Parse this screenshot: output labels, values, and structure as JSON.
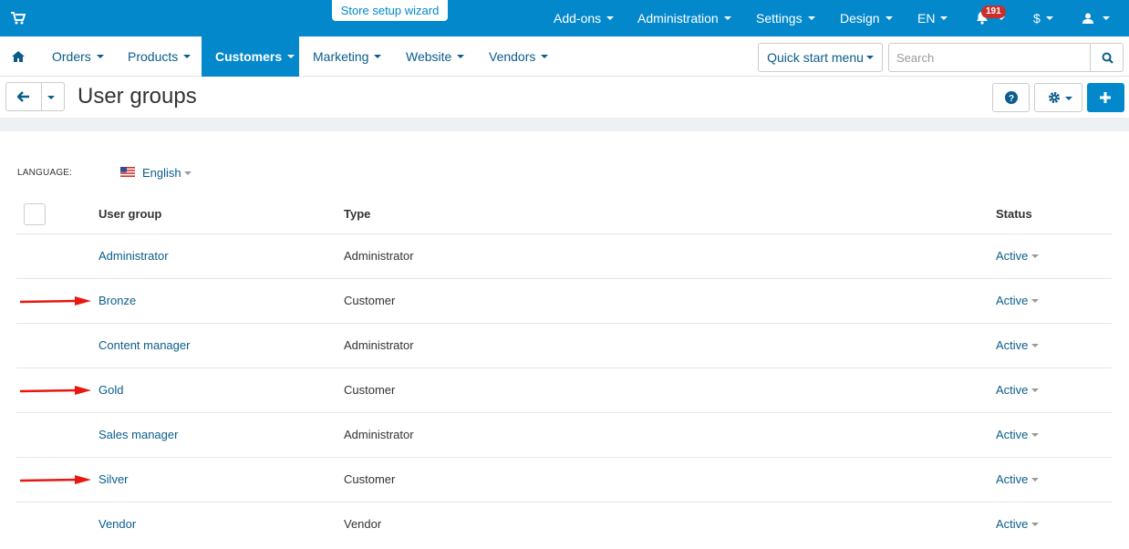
{
  "topbar": {
    "wizard_label": "Store setup wizard",
    "menus": [
      "Add-ons",
      "Administration",
      "Settings",
      "Design",
      "EN"
    ],
    "notifications_count": "191",
    "currency": "$",
    "bg_color": "#0388cc"
  },
  "mainnav": {
    "items": [
      "Orders",
      "Products",
      "Customers",
      "Marketing",
      "Website",
      "Vendors"
    ],
    "active": "Customers",
    "quick_start_label": "Quick start menu",
    "search_placeholder": "Search"
  },
  "page": {
    "title": "User groups"
  },
  "language": {
    "label": "LANGUAGE:",
    "value": "English"
  },
  "table": {
    "headers": [
      "User group",
      "Type",
      "Status"
    ],
    "rows": [
      {
        "name": "Administrator",
        "type": "Administrator",
        "status": "Active",
        "marked": false
      },
      {
        "name": "Bronze",
        "type": "Customer",
        "status": "Active",
        "marked": true
      },
      {
        "name": "Content manager",
        "type": "Administrator",
        "status": "Active",
        "marked": false
      },
      {
        "name": "Gold",
        "type": "Customer",
        "status": "Active",
        "marked": true
      },
      {
        "name": "Sales manager",
        "type": "Administrator",
        "status": "Active",
        "marked": false
      },
      {
        "name": "Silver",
        "type": "Customer",
        "status": "Active",
        "marked": true
      },
      {
        "name": "Vendor",
        "type": "Vendor",
        "status": "Active",
        "marked": false
      }
    ]
  },
  "colors": {
    "link": "#0a5d8a",
    "primary": "#0388cc",
    "annotation_arrow": "#e8170f"
  }
}
